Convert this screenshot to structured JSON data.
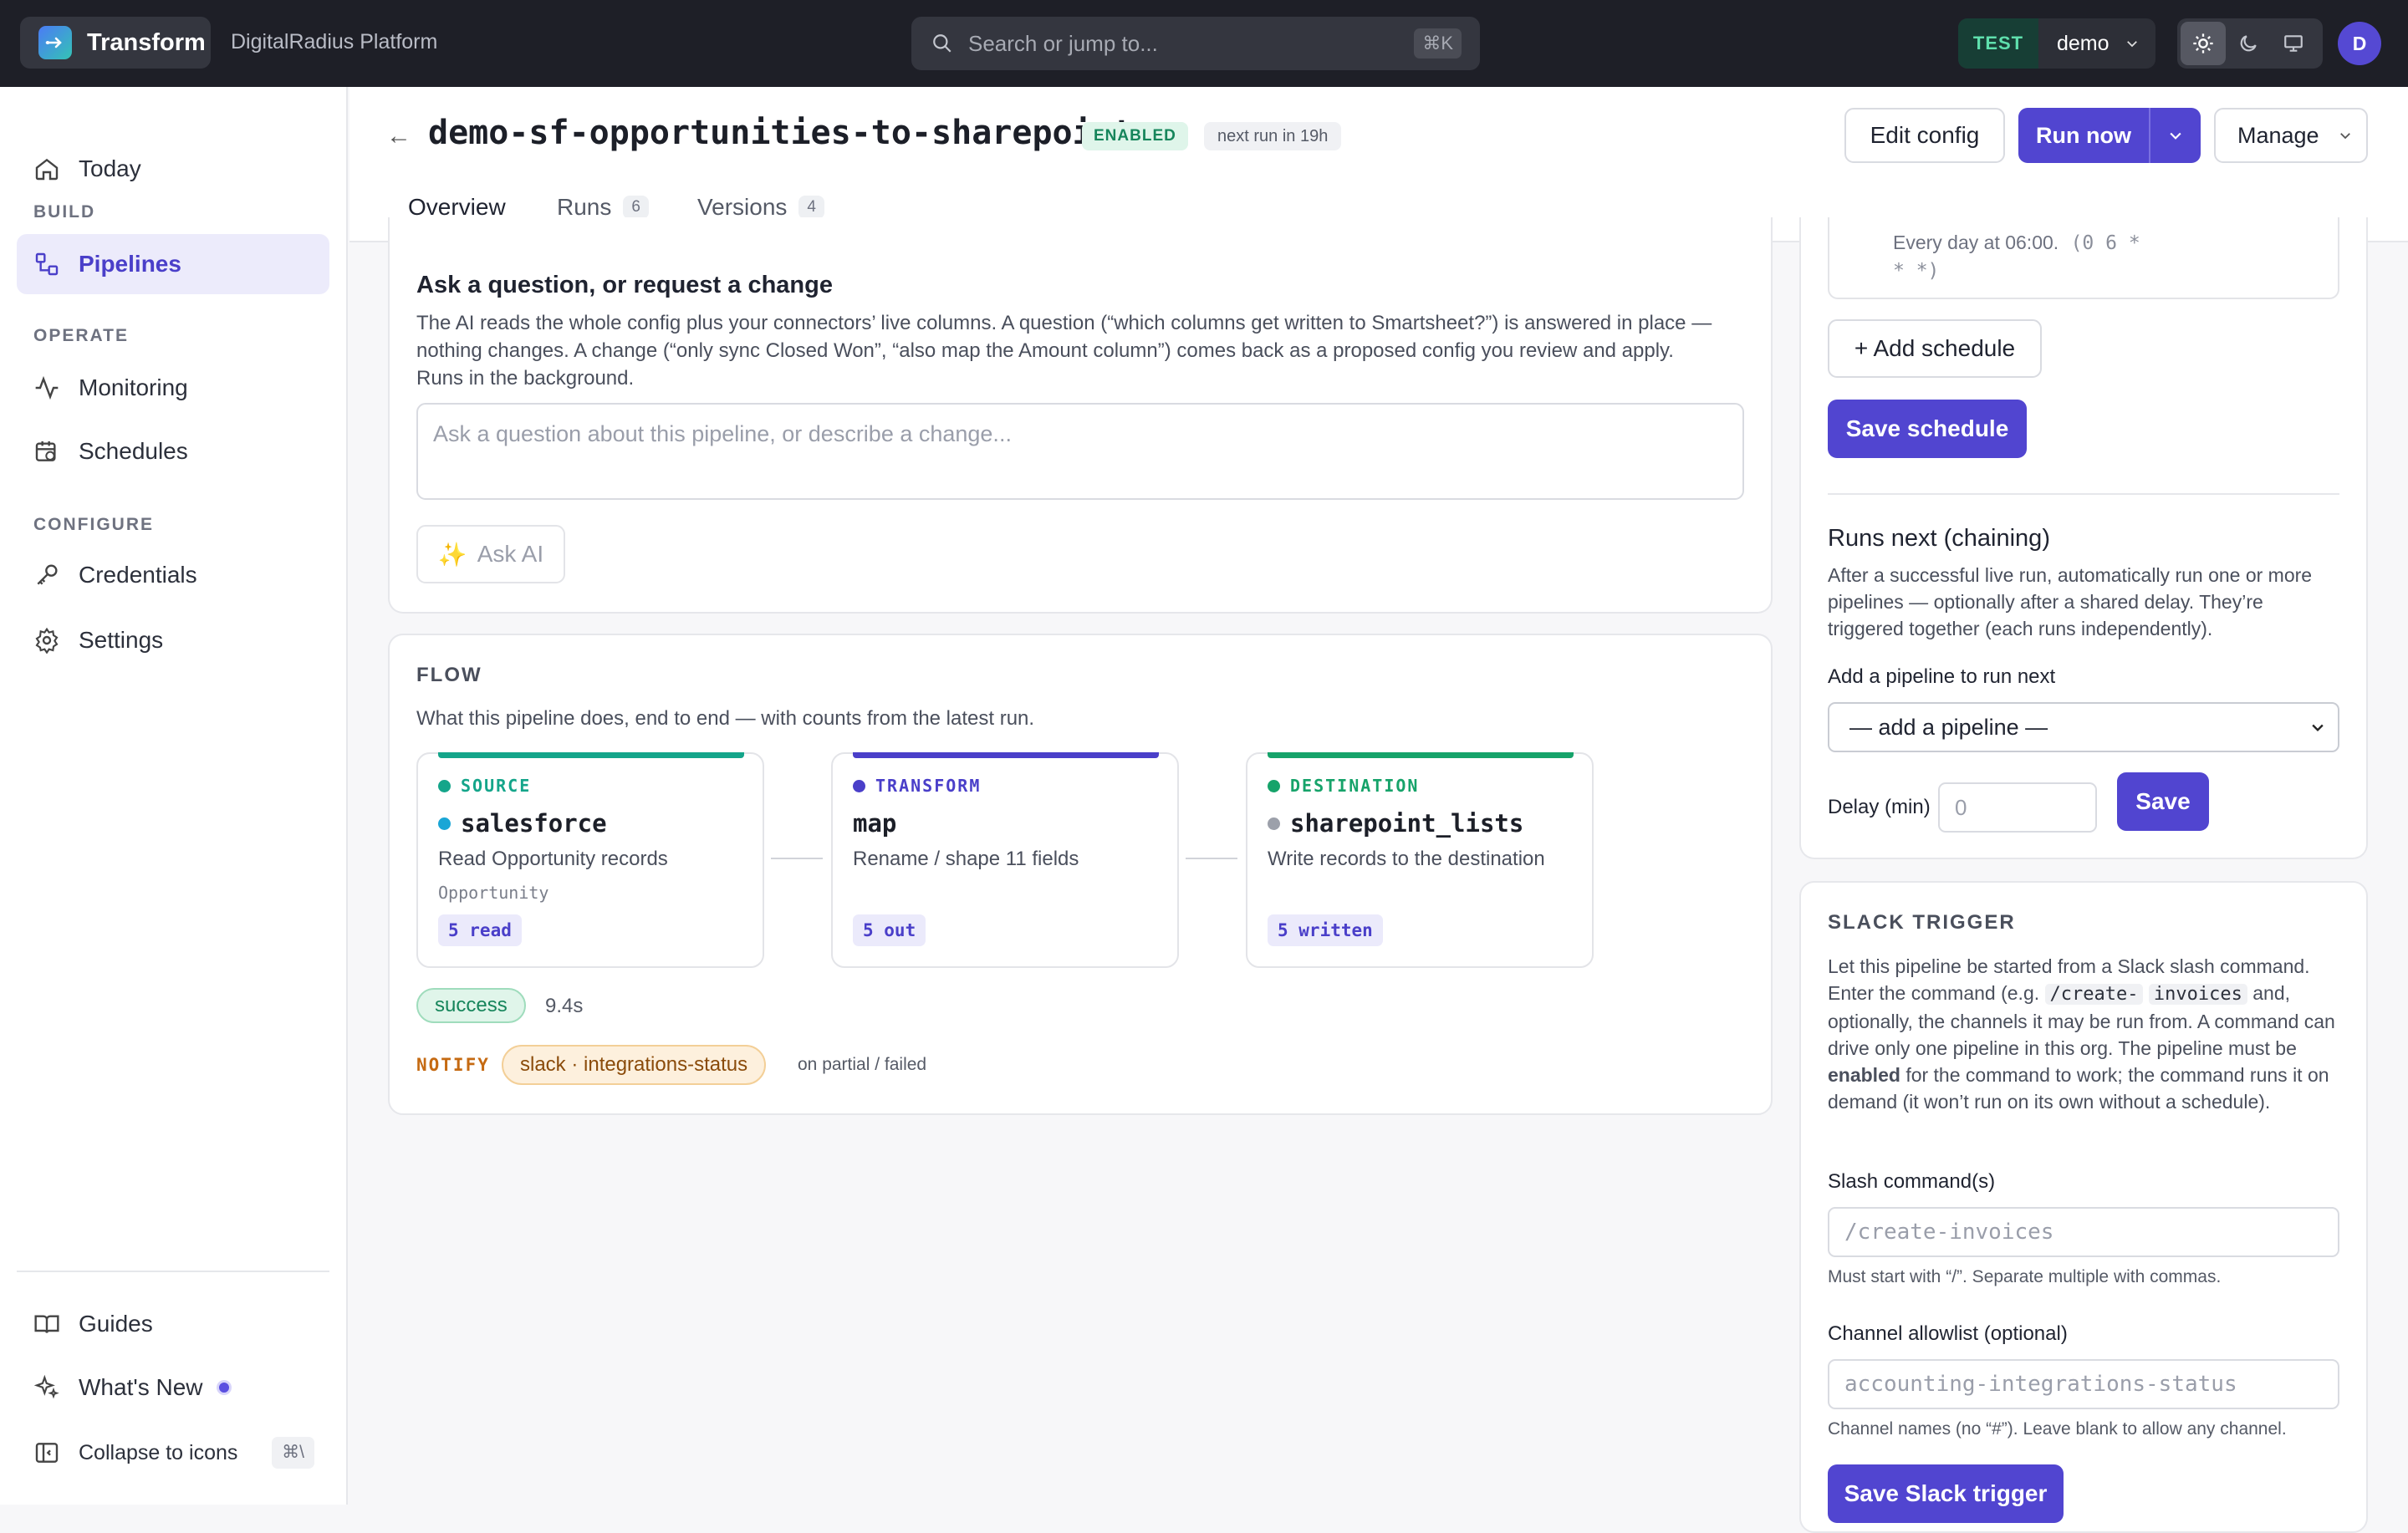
{
  "topbar": {
    "brand": "Transform",
    "platform": "DigitalRadius Platform",
    "search_placeholder": "Search or jump to...",
    "search_shortcut": "⌘K",
    "env_badge": "TEST",
    "env_name": "demo",
    "avatar_initial": "D"
  },
  "sidebar": {
    "today": "Today",
    "build_label": "BUILD",
    "pipelines": "Pipelines",
    "operate_label": "OPERATE",
    "monitoring": "Monitoring",
    "schedules": "Schedules",
    "configure_label": "CONFIGURE",
    "credentials": "Credentials",
    "settings": "Settings",
    "guides": "Guides",
    "whats_new": "What's New",
    "collapse": "Collapse to icons",
    "collapse_shortcut": "⌘\\"
  },
  "header": {
    "back": "←",
    "title": "demo-sf-opportunities-to-sharepoint",
    "status": "ENABLED",
    "next_run": "next run in 19h",
    "edit_config": "Edit config",
    "run_now": "Run now",
    "manage": "Manage"
  },
  "tabs": [
    {
      "label": "Overview",
      "count": ""
    },
    {
      "label": "Runs",
      "count": "6"
    },
    {
      "label": "Versions",
      "count": "4"
    }
  ],
  "ask": {
    "heading": "Ask a question, or request a change",
    "description": "The AI reads the whole config plus your connectors’ live columns. A question (“which columns get written to Smartsheet?”) is answered in place — nothing changes. A change (“only sync Closed Won”, “also map the Amount column”) comes back as a proposed config you review and apply. Runs in the background.",
    "placeholder": "Ask a question about this pipeline, or describe a change...",
    "button": "Ask AI"
  },
  "flow": {
    "heading": "FLOW",
    "description": "What this pipeline does, end to end — with counts from the latest run.",
    "nodes": [
      {
        "kind": "SOURCE",
        "name": "salesforce",
        "desc": "Read Opportunity records",
        "object": "Opportunity",
        "count": "5 read",
        "accent": "#14a58a",
        "name_dot": "#1aa6d6"
      },
      {
        "kind": "TRANSFORM",
        "name": "map",
        "desc": "Rename / shape 11 fields",
        "object": "",
        "count": "5 out",
        "accent": "#4a3fc9",
        "name_dot": ""
      },
      {
        "kind": "DESTINATION",
        "name": "sharepoint_lists",
        "desc": "Write records to the destination",
        "object": "",
        "count": "5 written",
        "accent": "#16a36a",
        "name_dot": "#9ca0aa"
      }
    ],
    "status": "success",
    "duration": "9.4s",
    "notify_label": "NOTIFY",
    "notify_target": "slack · integrations-status",
    "notify_when": "on partial / failed"
  },
  "schedule": {
    "existing_line1": "Every day at 06:00.",
    "existing_cron1": "(0 6 *",
    "existing_cron2": "* *)",
    "add_schedule": "+ Add schedule",
    "save_schedule": "Save schedule"
  },
  "chaining": {
    "heading": "Runs next (chaining)",
    "description": "After a successful live run, automatically run one or more pipelines — optionally after a shared delay. They’re triggered together (each runs independently).",
    "add_label": "Add a pipeline to run next",
    "select_value": "— add a pipeline —",
    "delay_label": "Delay (min)",
    "delay_placeholder": "0",
    "save": "Save"
  },
  "slack": {
    "heading": "SLACK TRIGGER",
    "desc_a": "Let this pipeline be started from a Slack slash command. Enter the command (e.g.",
    "desc_code1": "/create-",
    "desc_code2": "invoices",
    "desc_b": "and, optionally, the channels it may be run from. A command can drive only one pipeline in this org. The pipeline must be",
    "desc_bold": "enabled",
    "desc_c": "for the command to work; the command runs it on demand (it won’t run on its own without a schedule).",
    "slash_label": "Slash command(s)",
    "slash_placeholder": "/create-invoices",
    "slash_help": "Must start with “/”. Separate multiple with commas.",
    "allow_label": "Channel allowlist (optional)",
    "allow_placeholder": "accounting-integrations-status",
    "allow_help": "Channel names (no “#”). Leave blank to allow any channel.",
    "save": "Save Slack trigger"
  }
}
